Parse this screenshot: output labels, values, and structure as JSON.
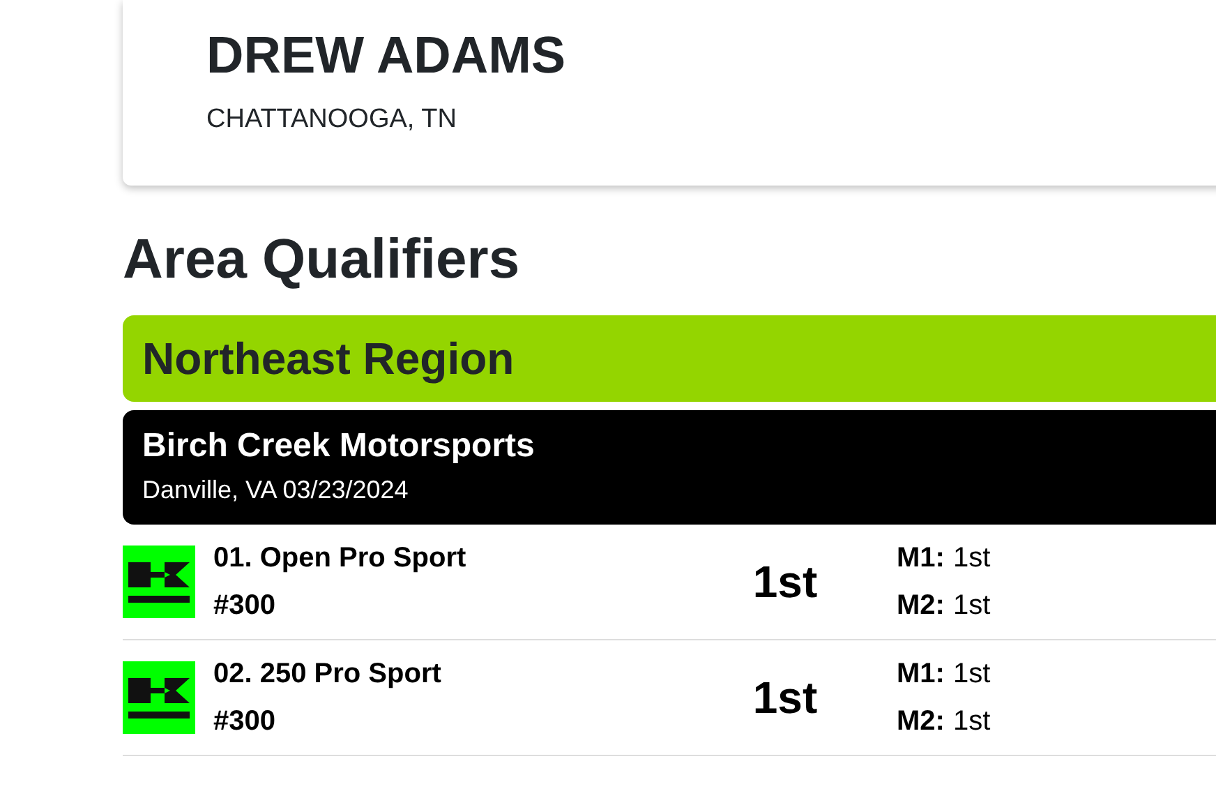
{
  "rider": {
    "name": "DREW ADAMS",
    "location": "CHATTANOOGA, TN"
  },
  "section_title": "Area Qualifiers",
  "region": "Northeast Region",
  "event": {
    "name": "Birch Creek Motorsports",
    "details": "Danville, VA 03/23/2024"
  },
  "results": [
    {
      "class": "01. Open Pro Sport",
      "number": "#300",
      "place": "1st",
      "motos": [
        {
          "label": "M1:",
          "result": "1st"
        },
        {
          "label": "M2:",
          "result": "1st"
        }
      ]
    },
    {
      "class": "02. 250 Pro Sport",
      "number": "#300",
      "place": "1st",
      "motos": [
        {
          "label": "M1:",
          "result": "1st"
        },
        {
          "label": "M2:",
          "result": "1st"
        }
      ]
    }
  ]
}
